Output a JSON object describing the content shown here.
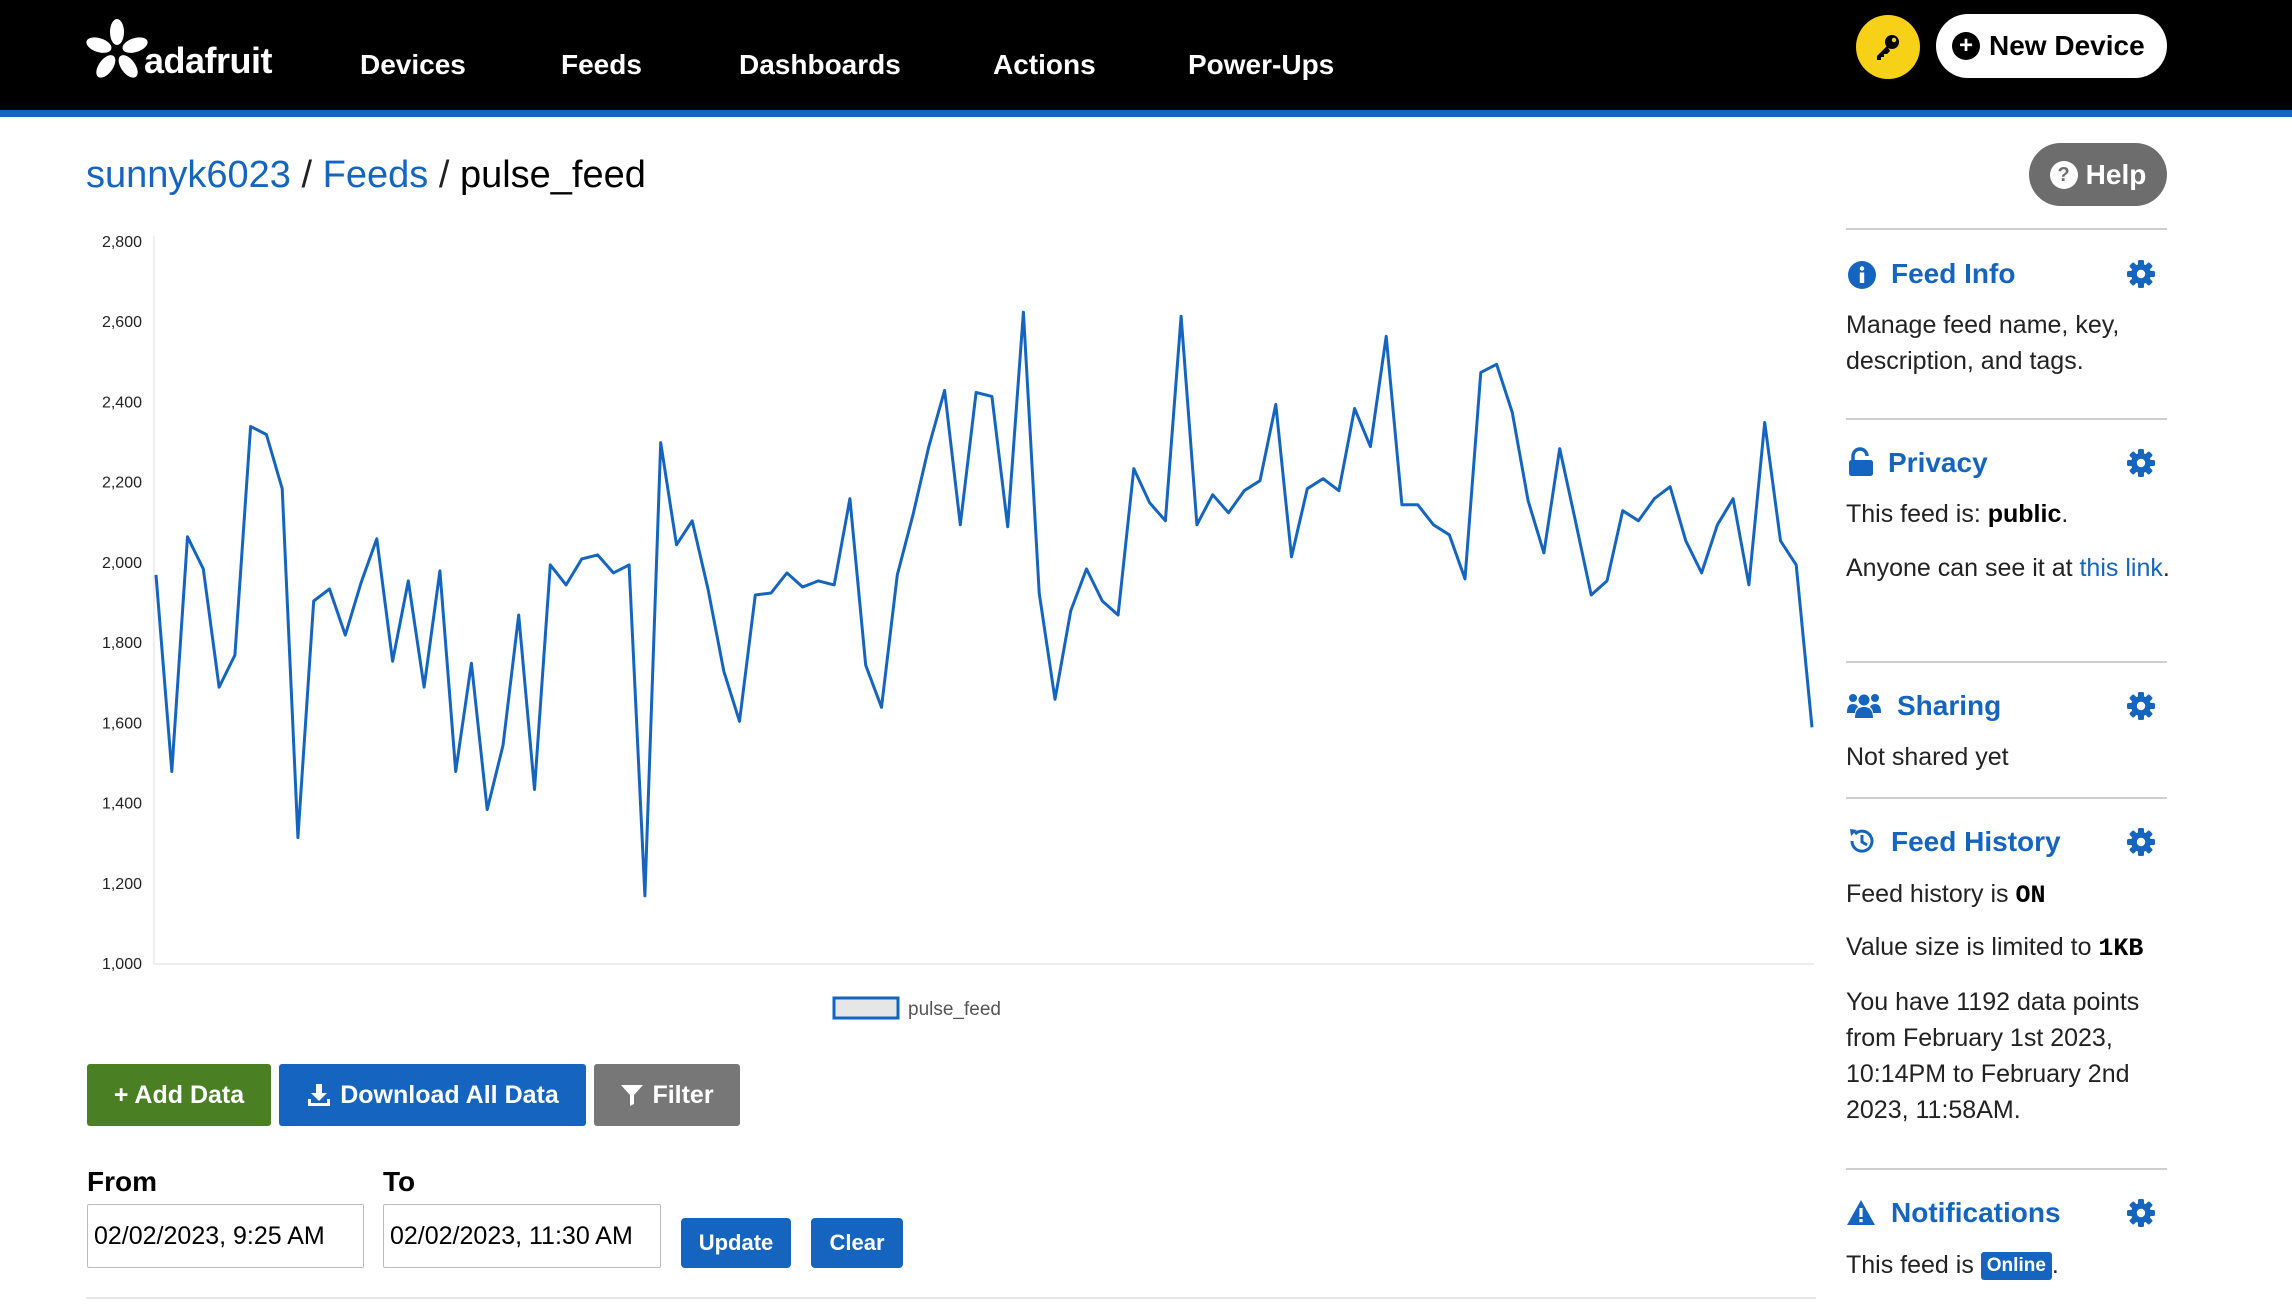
{
  "header": {
    "logo_text": "adafruit",
    "nav": [
      {
        "label": "Devices"
      },
      {
        "label": "Feeds"
      },
      {
        "label": "Dashboards"
      },
      {
        "label": "Actions"
      },
      {
        "label": "Power-Ups"
      }
    ],
    "key_icon": "key-icon",
    "new_device_label": "New Device"
  },
  "breadcrumb": {
    "user": "sunnyk6023",
    "sep1": "/",
    "feeds": "Feeds",
    "sep2": "/",
    "current": "pulse_feed"
  },
  "help_label": "Help",
  "colors": {
    "accent": "#1565c0",
    "add_button": "#4a7f23",
    "filter_button": "#777777",
    "key_button": "#f7d117"
  },
  "chart_data": {
    "type": "line",
    "series": [
      {
        "name": "pulse_feed",
        "values": [
          1970,
          1480,
          2065,
          1985,
          1690,
          1770,
          2340,
          2320,
          2185,
          1315,
          1905,
          1935,
          1820,
          1950,
          2060,
          1755,
          1955,
          1690,
          1980,
          1480,
          1750,
          1385,
          1545,
          1870,
          1435,
          1995,
          1945,
          2010,
          2020,
          1975,
          1995,
          1170,
          2300,
          2045,
          2105,
          1935,
          1730,
          1605,
          1920,
          1925,
          1975,
          1940,
          1955,
          1945,
          2160,
          1745,
          1640,
          1970,
          2120,
          2290,
          2430,
          2095,
          2425,
          2415,
          2090,
          2625,
          1925,
          1660,
          1880,
          1985,
          1905,
          1870,
          2235,
          2150,
          2105,
          2615,
          2095,
          2170,
          2125,
          2180,
          2205,
          2395,
          2015,
          2185,
          2210,
          2180,
          2385,
          2290,
          2565,
          2145,
          2145,
          2095,
          2070,
          1960,
          2475,
          2495,
          2375,
          2155,
          2025,
          2285,
          2105,
          1920,
          1955,
          2130,
          2105,
          2160,
          2190,
          2055,
          1975,
          2095,
          2160,
          1945,
          2350,
          2055,
          1995,
          1590
        ]
      }
    ],
    "ylim": [
      1000,
      2800
    ],
    "yticks": [
      "1,000",
      "1,200",
      "1,400",
      "1,600",
      "1,800",
      "2,000",
      "2,200",
      "2,400",
      "2,600",
      "2,800"
    ],
    "grid": false,
    "legend": "bottom-center",
    "legend_label": "pulse_feed"
  },
  "actions": {
    "add_data": "+ Add Data",
    "download": "Download All Data",
    "filter": "Filter"
  },
  "date_range": {
    "from_label": "From",
    "from_value": "02/02/2023, 9:25 AM",
    "to_label": "To",
    "to_value": "02/02/2023, 11:30 AM",
    "update": "Update",
    "clear": "Clear"
  },
  "sidebar": {
    "feed_info": {
      "title": "Feed Info",
      "desc": "Manage feed name, key, description, and tags."
    },
    "privacy": {
      "title": "Privacy",
      "status_prefix": "This feed is: ",
      "status": "public",
      "status_suffix": ".",
      "link_prefix": "Anyone can see it at ",
      "link_text": "this link",
      "link_suffix": "."
    },
    "sharing": {
      "title": "Sharing",
      "desc": "Not shared yet"
    },
    "history": {
      "title": "Feed History",
      "status_prefix": "Feed history is ",
      "status": "ON",
      "limit_prefix": "Value size is limited to ",
      "limit": "1KB",
      "points": "You have 1192 data points from February 1st 2023, 10:14PM to February 2nd 2023, 11:58AM."
    },
    "notifications": {
      "title": "Notifications",
      "prefix": "This feed is ",
      "badge": "Online",
      "suffix": "."
    }
  }
}
